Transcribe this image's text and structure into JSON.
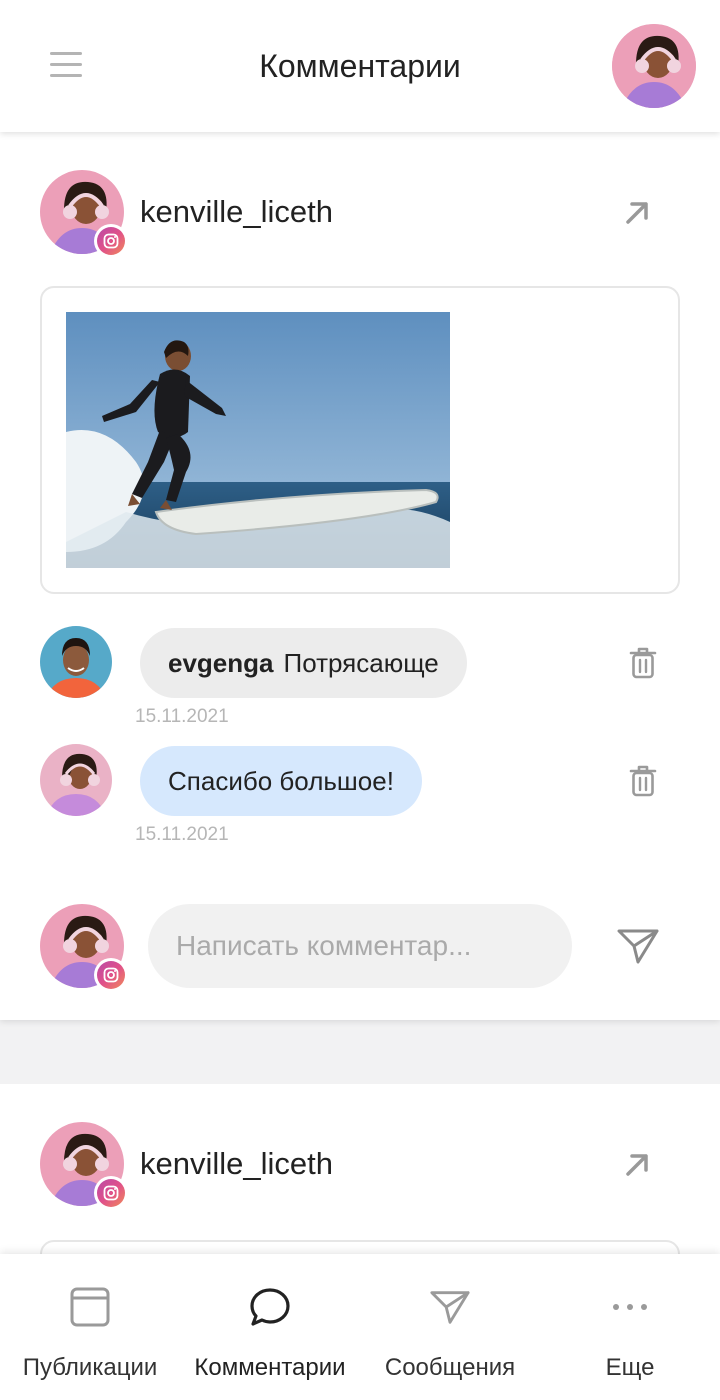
{
  "header": {
    "title": "Комментарии",
    "menu_icon": "hamburger-menu-icon",
    "avatar_icon": "user-avatar"
  },
  "posts": [
    {
      "author": "kenville_liceth",
      "network_icon": "instagram-icon",
      "open_icon": "arrow-up-right-icon",
      "media": "surfer-photo",
      "comments": [
        {
          "user": "evgenga",
          "text": "Потрясающе",
          "date": "15.11.2021",
          "style": "gray",
          "delete_icon": "trash-icon"
        },
        {
          "user": "",
          "text": "Спасибо большое!",
          "date": "15.11.2021",
          "style": "blue",
          "delete_icon": "trash-icon"
        }
      ],
      "compose": {
        "placeholder": "Написать комментар...",
        "send_icon": "send-icon"
      }
    },
    {
      "author": "kenville_liceth",
      "network_icon": "instagram-icon",
      "open_icon": "arrow-up-right-icon"
    }
  ],
  "bottom_nav": {
    "items": [
      {
        "label": "Публикации",
        "icon": "publications-icon",
        "active": false
      },
      {
        "label": "Комментарии",
        "icon": "comment-bubble-icon",
        "active": true
      },
      {
        "label": "Сообщения",
        "icon": "send-icon",
        "active": false
      },
      {
        "label": "Еще",
        "icon": "more-dots-icon",
        "active": false
      }
    ]
  },
  "colors": {
    "accent_bubble": "#d6e8fd",
    "gray_bubble": "#ececec",
    "instagram_gradient": [
      "#b84aa8",
      "#e0508a",
      "#f08a5a"
    ]
  }
}
